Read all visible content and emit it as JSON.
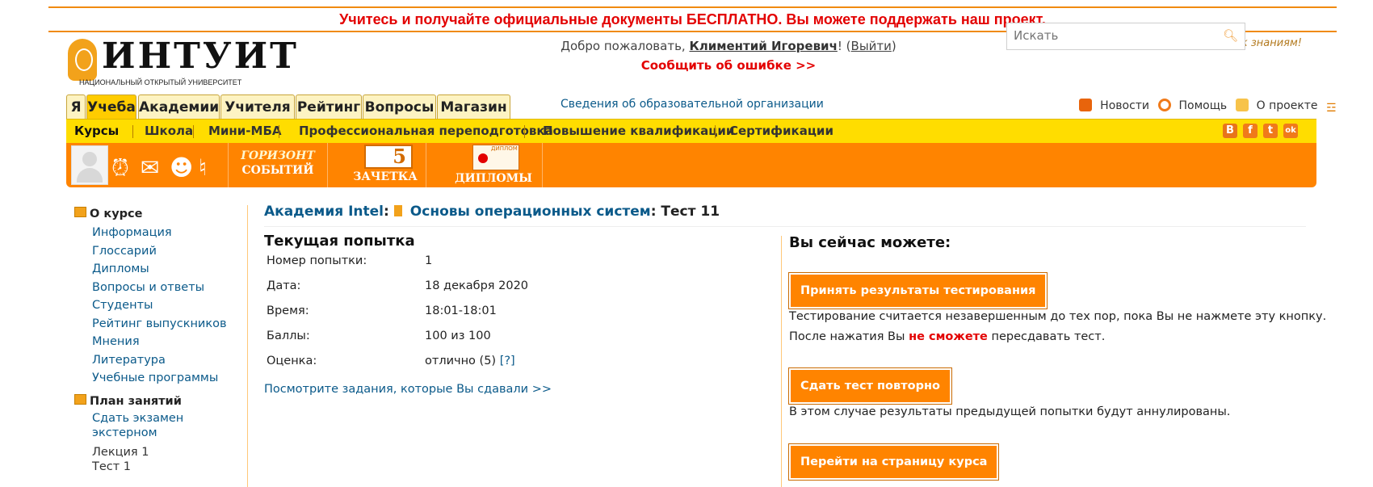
{
  "promo": "Учитесь и получайте официальные документы БЕСПЛАТНО. Вы можете поддержать наш проект.",
  "header": {
    "logo_big": "ИНТУИТ",
    "logo_small": "НАЦИОНАЛЬНЫЙ ОТКРЫТЫЙ УНИВЕРСИТЕТ",
    "welcome_prefix": "Добро пожаловать,",
    "user_name": "Климентий Игоревич",
    "welcome_bang": "!",
    "logout_open": "(",
    "logout": "Выйти",
    "logout_close": ")",
    "report_error": "Сообщить об ошибке >>",
    "slogan": "Твой путь к знаниям!",
    "search_placeholder": "Искать"
  },
  "tabs": [
    "Я",
    "Учеба",
    "Академии",
    "Учителя",
    "Рейтинг",
    "Вопросы",
    "Магазин"
  ],
  "active_tab": "Учеба",
  "org_link": "Сведения об образовательной организации",
  "top_links": {
    "news": "Новости",
    "help": "Помощь",
    "about": "О проекте"
  },
  "subnav": [
    "Курсы",
    "Школа",
    "Мини-МБА",
    "Профессиональная переподготовка",
    "Повышение квалификации",
    "Сертификации"
  ],
  "social": [
    "B",
    "f",
    "t",
    "ok"
  ],
  "orange_bar": {
    "horizon_line1": "ГОРИЗОНТ",
    "horizon_line2": "СОБЫТИЙ",
    "zachetka_num": "5",
    "zachetka": "ЗАЧЕТКА",
    "diploma_badge": "ДИПЛОМ",
    "diplomas": "ДИПЛОМЫ"
  },
  "sidebar": {
    "about_title": "О курсе",
    "about_items": [
      "Информация",
      "Глоссарий",
      "Дипломы",
      "Вопросы и ответы",
      "Студенты",
      "Рейтинг выпускников",
      "Мнения",
      "Литература",
      "Учебные программы"
    ],
    "plan_title": "План занятий",
    "plan_link_line1": "Сдать экзамен",
    "plan_link_line2": "экстерном",
    "plan_items": [
      "Лекция 1",
      "Тест 1"
    ]
  },
  "breadcrumb": {
    "academy": "Академия Intel",
    "colon1": ":",
    "course": "Основы операционных систем",
    "rest": ": Тест 11"
  },
  "attempt": {
    "title": "Текущая попытка",
    "rows": [
      {
        "k": "Номер попытки:",
        "v": "1"
      },
      {
        "k": "Дата:",
        "v": "18 декабря 2020"
      },
      {
        "k": "Время:",
        "v": "18:01-18:01"
      },
      {
        "k": "Баллы:",
        "v": "100 из 100"
      },
      {
        "k": "Оценка:",
        "v": "отлично (5)"
      }
    ],
    "help": "[?]",
    "see_tasks": "Посмотрите задания, которые Вы сдавали >>"
  },
  "actions": {
    "title": "Вы сейчас можете:",
    "accept_btn": "Принять результаты тестирования",
    "accept_note1": "Тестирование считается незавершенным до тех пор, пока Вы не нажмете эту кнопку.",
    "accept_note2_a": "После нажатия Вы",
    "accept_note2_red": "не сможете",
    "accept_note2_b": "пересдавать тест.",
    "retake_btn": "Сдать тест повторно",
    "retake_note": "В этом случае результаты предыдущей попытки будут аннулированы.",
    "course_btn": "Перейти на страницу курса"
  }
}
